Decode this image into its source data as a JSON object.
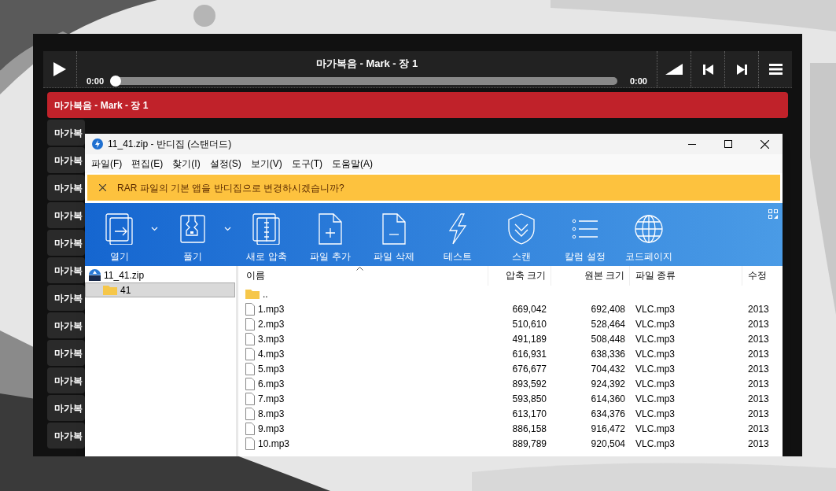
{
  "player": {
    "title": "마가복음 - Mark - 장 1",
    "elapsed": "0:00",
    "duration": "0:00",
    "level": 0,
    "playing": false
  },
  "playlist": [
    {
      "title": "마가복음 - Mark - 장 1",
      "selected": true
    },
    {
      "title": "마가복",
      "selected": false
    },
    {
      "title": "마가복",
      "selected": false
    },
    {
      "title": "마가복",
      "selected": false
    },
    {
      "title": "마가복",
      "selected": false
    },
    {
      "title": "마가복",
      "selected": false
    },
    {
      "title": "마가복",
      "selected": false
    },
    {
      "title": "마가복",
      "selected": false
    },
    {
      "title": "마가복",
      "selected": false
    },
    {
      "title": "마가복",
      "selected": false
    },
    {
      "title": "마가복",
      "selected": false
    },
    {
      "title": "마가복",
      "selected": false
    },
    {
      "title": "마가복",
      "selected": false
    }
  ],
  "window": {
    "title": "11_41.zip - 반디집 (스탠더드)",
    "menu": [
      "파일(F)",
      "편집(E)",
      "찾기(I)",
      "설정(S)",
      "보기(V)",
      "도구(T)",
      "도움말(A)"
    ],
    "banner": "RAR 파일의 기본 앱을 반디집으로 변경하시겠습니까?",
    "toolbar": [
      {
        "label": "열기",
        "kind": "open",
        "dropdown": true
      },
      {
        "label": "풀기",
        "kind": "extract",
        "dropdown": true
      },
      {
        "label": "새로 압축",
        "kind": "archive",
        "dropdown": false
      },
      {
        "label": "파일 추가",
        "kind": "add",
        "dropdown": false
      },
      {
        "label": "파일 삭제",
        "kind": "remove",
        "dropdown": false
      },
      {
        "label": "테스트",
        "kind": "bolt",
        "dropdown": false
      },
      {
        "label": "스캔",
        "kind": "shield",
        "dropdown": false
      },
      {
        "label": "칼럼 설정",
        "kind": "list",
        "dropdown": false
      },
      {
        "label": "코드페이지",
        "kind": "globe",
        "dropdown": false
      }
    ],
    "tree": [
      {
        "label": "11_41.zip",
        "kind": "archive",
        "selected": false,
        "children": [
          {
            "label": "41",
            "kind": "folder",
            "selected": true
          }
        ]
      }
    ],
    "columns": [
      "이름",
      "압축 크기",
      "원본 크기",
      "파일 종류",
      "수정"
    ],
    "rows": [
      {
        "kind": "folder",
        "name": ".."
      },
      {
        "kind": "file",
        "name": "1.mp3",
        "packed": "669,042",
        "size": "692,408",
        "type": "VLC.mp3",
        "modified": "2013"
      },
      {
        "kind": "file",
        "name": "2.mp3",
        "packed": "510,610",
        "size": "528,464",
        "type": "VLC.mp3",
        "modified": "2013"
      },
      {
        "kind": "file",
        "name": "3.mp3",
        "packed": "491,189",
        "size": "508,448",
        "type": "VLC.mp3",
        "modified": "2013"
      },
      {
        "kind": "file",
        "name": "4.mp3",
        "packed": "616,931",
        "size": "638,336",
        "type": "VLC.mp3",
        "modified": "2013"
      },
      {
        "kind": "file",
        "name": "5.mp3",
        "packed": "676,677",
        "size": "704,432",
        "type": "VLC.mp3",
        "modified": "2013"
      },
      {
        "kind": "file",
        "name": "6.mp3",
        "packed": "893,592",
        "size": "924,392",
        "type": "VLC.mp3",
        "modified": "2013"
      },
      {
        "kind": "file",
        "name": "7.mp3",
        "packed": "593,850",
        "size": "614,360",
        "type": "VLC.mp3",
        "modified": "2013"
      },
      {
        "kind": "file",
        "name": "8.mp3",
        "packed": "613,170",
        "size": "634,376",
        "type": "VLC.mp3",
        "modified": "2013"
      },
      {
        "kind": "file",
        "name": "9.mp3",
        "packed": "886,158",
        "size": "916,472",
        "type": "VLC.mp3",
        "modified": "2013"
      },
      {
        "kind": "file",
        "name": "10.mp3",
        "packed": "889,789",
        "size": "920,504",
        "type": "VLC.mp3",
        "modified": "2013"
      }
    ]
  }
}
